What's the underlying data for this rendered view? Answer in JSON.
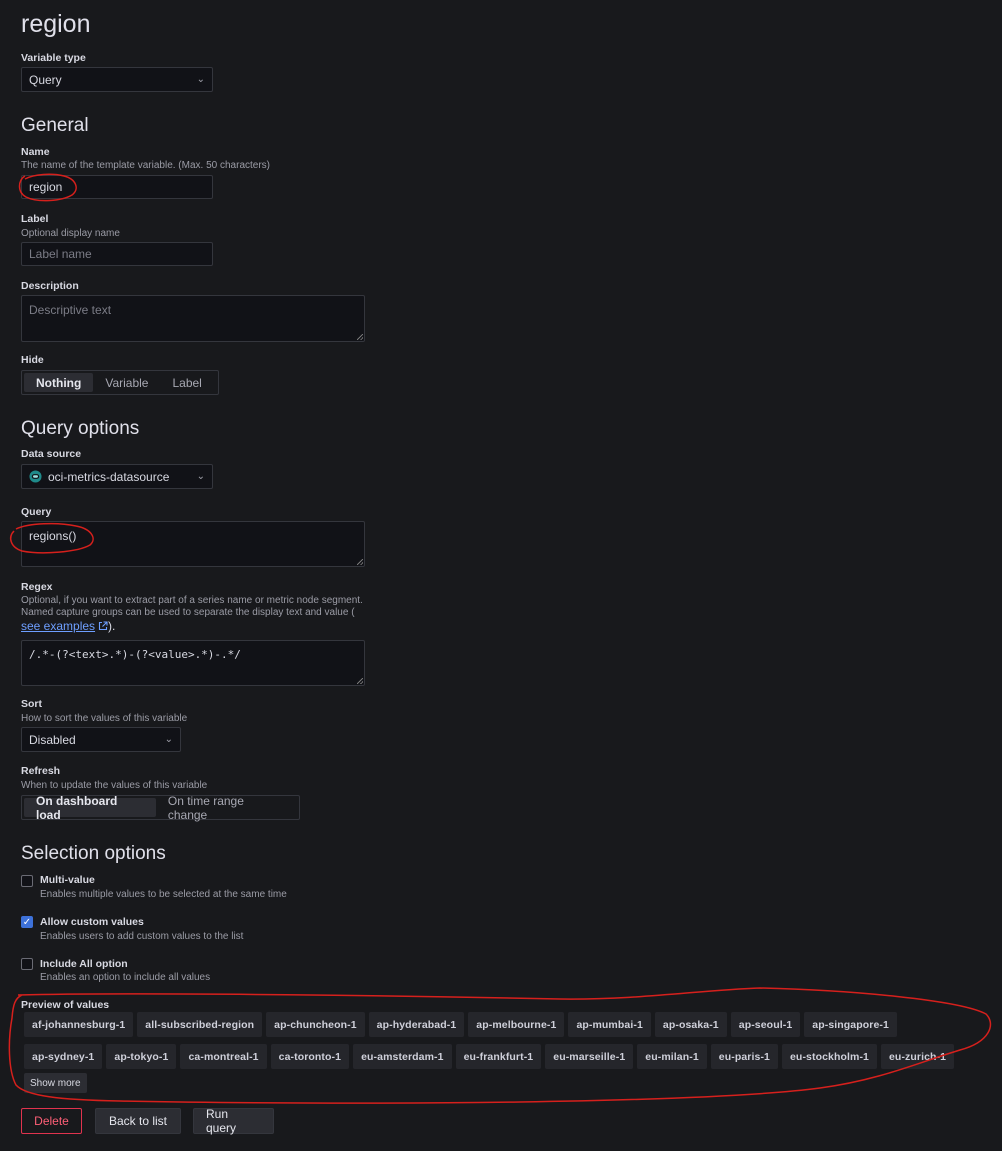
{
  "page_title": "region",
  "variable_type": {
    "label": "Variable type",
    "value": "Query"
  },
  "general": {
    "heading": "General",
    "name": {
      "label": "Name",
      "description": "The name of the template variable. (Max. 50 characters)",
      "value": "region"
    },
    "label_field": {
      "label": "Label",
      "description": "Optional display name",
      "placeholder": "Label name"
    },
    "description_field": {
      "label": "Description",
      "placeholder": "Descriptive text"
    },
    "hide": {
      "label": "Hide",
      "options": [
        "Nothing",
        "Variable",
        "Label"
      ],
      "selected": "Nothing"
    }
  },
  "query_options": {
    "heading": "Query options",
    "data_source": {
      "label": "Data source",
      "value": "oci-metrics-datasource"
    },
    "query": {
      "label": "Query",
      "value": "regions()"
    },
    "regex": {
      "label": "Regex",
      "description_1": "Optional, if you want to extract part of a series name or metric node segment.",
      "description_2": "Named capture groups can be used to separate the display text and value (",
      "link_text": "see examples",
      "description_end": ").",
      "value": "/.*-(?<text>.*)-(?<value>.*)-.*/"
    },
    "sort": {
      "label": "Sort",
      "description": "How to sort the values of this variable",
      "value": "Disabled"
    },
    "refresh": {
      "label": "Refresh",
      "description": "When to update the values of this variable",
      "options": [
        "On dashboard load",
        "On time range change"
      ],
      "selected": "On dashboard load"
    }
  },
  "selection_options": {
    "heading": "Selection options",
    "multi_value": {
      "title": "Multi-value",
      "description": "Enables multiple values to be selected at the same time",
      "checked": false
    },
    "custom_values": {
      "title": "Allow custom values",
      "description": "Enables users to add custom values to the list",
      "checked": true
    },
    "include_all": {
      "title": "Include All option",
      "description": "Enables an option to include all values",
      "checked": false
    }
  },
  "preview": {
    "label": "Preview of values",
    "values": [
      "af-johannesburg-1",
      "all-subscribed-region",
      "ap-chuncheon-1",
      "ap-hyderabad-1",
      "ap-melbourne-1",
      "ap-mumbai-1",
      "ap-osaka-1",
      "ap-seoul-1",
      "ap-singapore-1",
      "ap-sydney-1",
      "ap-tokyo-1",
      "ca-montreal-1",
      "ca-toronto-1",
      "eu-amsterdam-1",
      "eu-frankfurt-1",
      "eu-marseille-1",
      "eu-milan-1",
      "eu-paris-1",
      "eu-stockholm-1",
      "eu-zurich-1"
    ],
    "show_more": "Show more"
  },
  "buttons": {
    "delete": "Delete",
    "back": "Back to list",
    "run": "Run query"
  },
  "colors": {
    "background": "#18191c",
    "annotation": "#d6201c",
    "accent": "#3d71d9",
    "danger": "#e0334e"
  }
}
